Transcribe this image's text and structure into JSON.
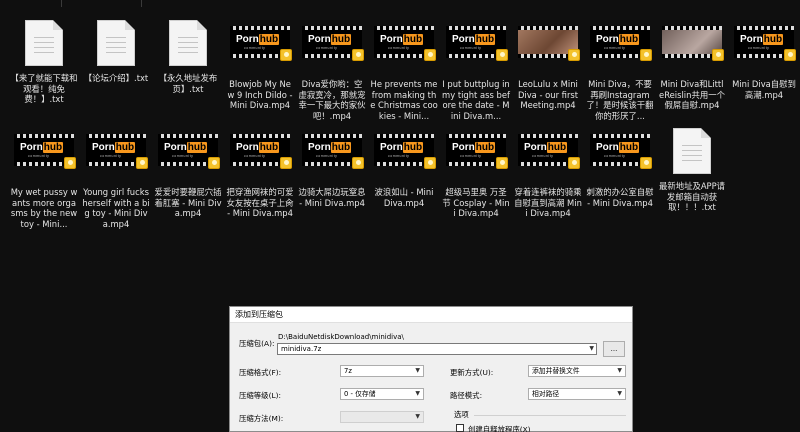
{
  "files": [
    {
      "type": "txt",
      "label": "【来了就能下载和观看！纯免费！】.txt"
    },
    {
      "type": "txt",
      "label": "【论坛介绍】.txt"
    },
    {
      "type": "txt",
      "label": "【永久地址发布页】.txt"
    },
    {
      "type": "video",
      "label": "Blowjob My New 9 Inch Dildo - Mini Diva.mp4"
    },
    {
      "type": "video",
      "label": "Diva爱你哟：空虚寂寞冷，那就宠幸一下最大的家伙吧！.mp4"
    },
    {
      "type": "video",
      "label": "He prevents me from making the Christmas cookies - Mini..."
    },
    {
      "type": "video",
      "label": "I put buttplug in my tight ass before the date - Mini Diva.m..."
    },
    {
      "type": "photo",
      "label": "LeoLulu x Mini Diva - our first Meeting.mp4"
    },
    {
      "type": "video",
      "label": "Mini Diva，不要再刷Instagram了！是时候该干翻你的形厌了..."
    },
    {
      "type": "photo2",
      "label": "Mini Diva和LittleReislin共用一个假屌自慰.mp4"
    },
    {
      "type": "video",
      "label": "Mini Diva自慰到高潮.mp4"
    },
    {
      "type": "video",
      "label": "My wet pussy wants more orgasms by the new toy - Mini..."
    },
    {
      "type": "video",
      "label": "Young girl fucks herself with a big toy - Mini Diva.mp4"
    },
    {
      "type": "video",
      "label": "爱爱时要鞭屁穴插着肛塞 - Mini Diva.mp4"
    },
    {
      "type": "video",
      "label": "把穿渔网袜的可爱女友按在桌子上肏 - Mini Diva.mp4"
    },
    {
      "type": "video",
      "label": "边骑大屌边玩窒息 - Mini Diva.mp4"
    },
    {
      "type": "video",
      "label": "波浪如山 - Mini Diva.mp4"
    },
    {
      "type": "video",
      "label": "超级马里奥 万圣节 Cosplay - Mini Diva.mp4"
    },
    {
      "type": "video",
      "label": "穿着连裤袜的骑乘自慰直到高潮 Mini Diva.mp4"
    },
    {
      "type": "video",
      "label": "刺激的办公室自慰 - Mini Diva.mp4"
    },
    {
      "type": "txt",
      "label": "最新地址及APP请发邮箱自动获取！！！.txt"
    }
  ],
  "video_brand": {
    "part1": "Porn",
    "part2": "hub",
    "sub": "community"
  },
  "dialog": {
    "title": "添加到压缩包",
    "archive_label": "压缩包(A):",
    "path": "D:\\BaiduNetdiskDownload\\minidiva\\",
    "archive_name": "minidiva.7z",
    "browse_label": "...",
    "format_label": "压缩格式(F):",
    "format_value": "7z",
    "level_label": "压缩等级(L):",
    "level_value": "0 - 仅存储",
    "method_label": "压缩方法(M):",
    "method_value": "",
    "update_label": "更新方式(U):",
    "update_value": "添加并替换文件",
    "pathmode_label": "路径模式:",
    "pathmode_value": "相对路径",
    "options_label": "选项",
    "sfx_label": "创建自释放程序(X)"
  }
}
